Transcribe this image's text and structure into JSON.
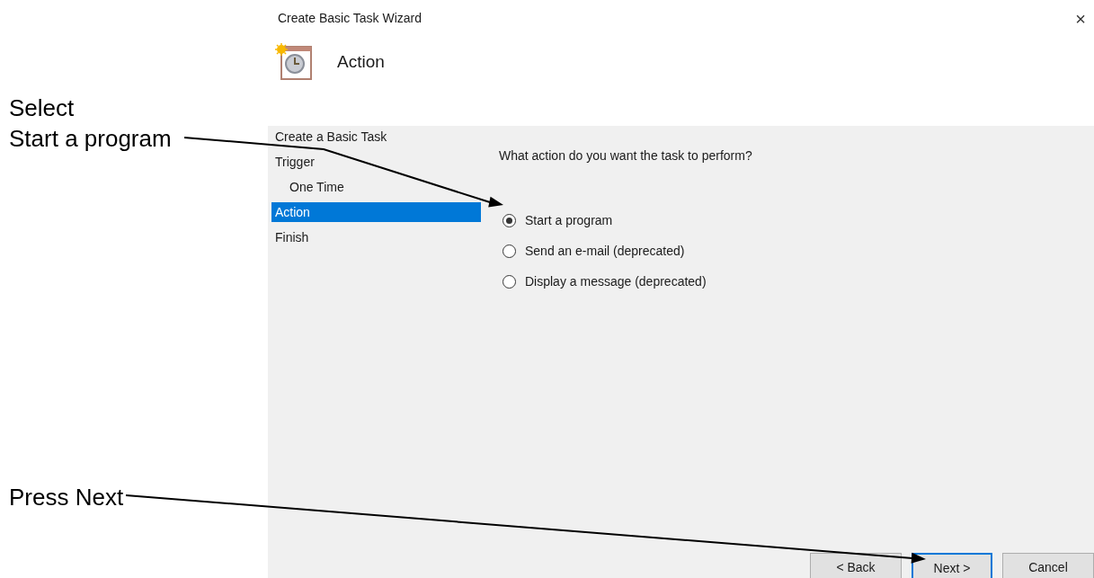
{
  "window": {
    "title": "Create Basic Task Wizard",
    "close": "×"
  },
  "header": {
    "title": "Action"
  },
  "steps": [
    {
      "label": "Create a Basic Task",
      "selected": false
    },
    {
      "label": "Trigger",
      "selected": false,
      "children": [
        {
          "label": "One Time",
          "selected": false
        }
      ]
    },
    {
      "label": "Action",
      "selected": true
    },
    {
      "label": "Finish",
      "selected": false
    }
  ],
  "question": "What action do you want the task to perform?",
  "options": [
    {
      "label": "Start a program",
      "selected": true
    },
    {
      "label": "Send an e-mail (deprecated)",
      "selected": false
    },
    {
      "label": "Display a message (deprecated)",
      "selected": false
    }
  ],
  "buttons": [
    {
      "label": "< Back",
      "default": false
    },
    {
      "label": "Next >",
      "default": true
    },
    {
      "label": "Cancel",
      "default": false
    }
  ],
  "annotations": [
    {
      "lines": [
        "Select",
        "Start a program"
      ]
    },
    {
      "lines": [
        "Press Next"
      ]
    }
  ]
}
